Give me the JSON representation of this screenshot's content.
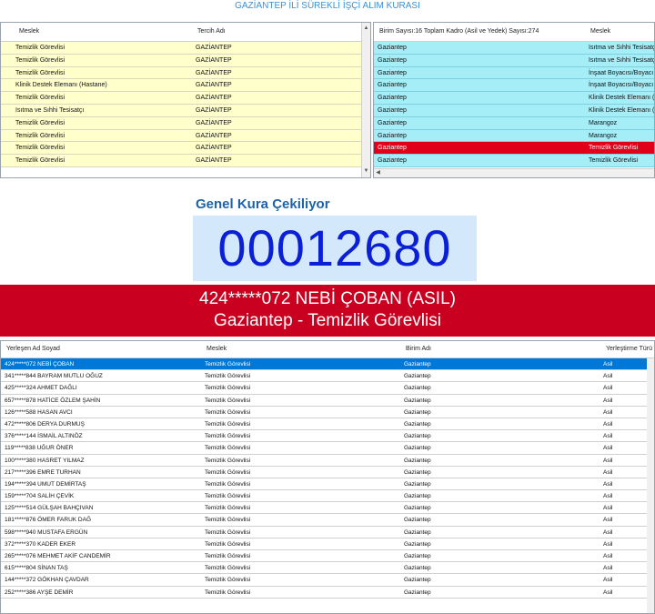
{
  "app": {
    "title": "GAZİANTEP İLİ SÜREKLİ İŞÇİ ALIM KURASI"
  },
  "left_grid": {
    "columns": [
      "Meslek",
      "Tercih Adı"
    ],
    "rows": [
      [
        "Temizlik Görevlisi",
        "GAZİANTEP"
      ],
      [
        "Temizlik Görevlisi",
        "GAZİANTEP"
      ],
      [
        "Temizlik Görevlisi",
        "GAZİANTEP"
      ],
      [
        "Klinik Destek Elemanı (Hastane)",
        "GAZİANTEP"
      ],
      [
        "Temizlik Görevlisi",
        "GAZİANTEP"
      ],
      [
        "Isıtma ve Sıhhi Tesisatçı",
        "GAZİANTEP"
      ],
      [
        "Temizlik Görevlisi",
        "GAZİANTEP"
      ],
      [
        "Temizlik Görevlisi",
        "GAZİANTEP"
      ],
      [
        "Temizlik Görevlisi",
        "GAZİANTEP"
      ],
      [
        "Temizlik Görevlisi",
        "GAZİANTEP"
      ]
    ]
  },
  "right_grid": {
    "columns": [
      "Birim Sayısı:16 Toplam Kadro (Asil ve Yedek) Sayısı:274",
      "Meslek"
    ],
    "rows": [
      [
        "Gaziantep",
        "Isıtma ve Sıhhi Tesisatçı"
      ],
      [
        "Gaziantep",
        "Isıtma ve Sıhhi Tesisatçı"
      ],
      [
        "Gaziantep",
        "İnşaat Boyacısı/Boyacı"
      ],
      [
        "Gaziantep",
        "İnşaat Boyacısı/Boyacı"
      ],
      [
        "Gaziantep",
        "Klinik Destek Elemanı (Hastane)"
      ],
      [
        "Gaziantep",
        "Klinik Destek Elemanı (Hastane)"
      ],
      [
        "Gaziantep",
        "Marangoz"
      ],
      [
        "Gaziantep",
        "Marangoz"
      ],
      [
        "Gaziantep",
        "Temizlik Görevlisi"
      ],
      [
        "Gaziantep",
        "Temizlik Görevlisi"
      ]
    ],
    "selected_row": 8
  },
  "draw": {
    "heading": "Genel Kura Çekiliyor",
    "number": "00012680",
    "winner_line1": "424*****072 NEBİ ÇOBAN (ASIL)",
    "winner_line2": "Gaziantep - Temizlik Görevlisi"
  },
  "result_grid": {
    "columns": [
      "Yerleşen Ad Soyad",
      "Meslek",
      "Birim Adı",
      "Yerleştirme Türü"
    ],
    "rows": [
      [
        "424*****072 NEBİ ÇOBAN",
        "Temizlik Görevlisi",
        "Gaziantep",
        "Asil"
      ],
      [
        "341*****844 BAYRAM MUTLU OĞUZ",
        "Temizlik Görevlisi",
        "Gaziantep",
        "Asil"
      ],
      [
        "425*****324 AHMET DAĞLI",
        "Temizlik Görevlisi",
        "Gaziantep",
        "Asil"
      ],
      [
        "657*****878 HATİCE ÖZLEM ŞAHİN",
        "Temizlik Görevlisi",
        "Gaziantep",
        "Asil"
      ],
      [
        "126*****588 HASAN AVCI",
        "Temizlik Görevlisi",
        "Gaziantep",
        "Asil"
      ],
      [
        "472*****806 DERYA DURMUŞ",
        "Temizlik Görevlisi",
        "Gaziantep",
        "Asil"
      ],
      [
        "376*****144 İSMAİL ALTINÖZ",
        "Temizlik Görevlisi",
        "Gaziantep",
        "Asil"
      ],
      [
        "119*****838 UĞUR ÖNER",
        "Temizlik Görevlisi",
        "Gaziantep",
        "Asil"
      ],
      [
        "100*****380 HASRET YILMAZ",
        "Temizlik Görevlisi",
        "Gaziantep",
        "Asil"
      ],
      [
        "217*****396 EMRE TURHAN",
        "Temizlik Görevlisi",
        "Gaziantep",
        "Asil"
      ],
      [
        "194*****394 UMUT DEMİRTAŞ",
        "Temizlik Görevlisi",
        "Gaziantep",
        "Asil"
      ],
      [
        "159*****704 SALİH ÇEVİK",
        "Temizlik Görevlisi",
        "Gaziantep",
        "Asil"
      ],
      [
        "125*****514 GÜLŞAH BAHÇIVAN",
        "Temizlik Görevlisi",
        "Gaziantep",
        "Asil"
      ],
      [
        "181*****876 ÖMER FARUK DAĞ",
        "Temizlik Görevlisi",
        "Gaziantep",
        "Asil"
      ],
      [
        "598*****940 MUSTAFA ERGÜN",
        "Temizlik Görevlisi",
        "Gaziantep",
        "Asil"
      ],
      [
        "372*****370 KADER EKER",
        "Temizlik Görevlisi",
        "Gaziantep",
        "Asil"
      ],
      [
        "265*****076 MEHMET AKİF CANDEMİR",
        "Temizlik Görevlisi",
        "Gaziantep",
        "Asil"
      ],
      [
        "615*****804 SİNAN TAŞ",
        "Temizlik Görevlisi",
        "Gaziantep",
        "Asil"
      ],
      [
        "144*****372 GÖKHAN ÇAVDAR",
        "Temizlik Görevlisi",
        "Gaziantep",
        "Asil"
      ],
      [
        "252*****386 AYŞE DEMİR",
        "Temizlik Görevlisi",
        "Gaziantep",
        "Asil"
      ]
    ],
    "selected_row": 0
  },
  "icons": {
    "scroll_up": "▲",
    "scroll_down": "▼",
    "scroll_left": "◀"
  },
  "colors": {
    "left_rows": "#ffffcc",
    "right_rows": "#a6eef7",
    "highlight_red": "#c9001f",
    "selection_blue": "#0078d7",
    "counter_blue": "#0a1fd6"
  }
}
